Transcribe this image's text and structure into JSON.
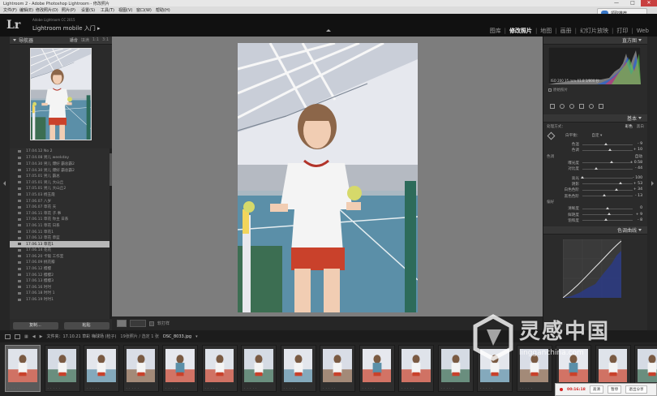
{
  "os": {
    "title": "Lightroom 2 - Adobe Photoshop Lightroom - 修改照片",
    "menu": [
      "文件(F)",
      "编辑(E)",
      "修改照片(D)",
      "照片(P)",
      "设置(S)",
      "工具(T)",
      "视图(V)",
      "窗口(W)",
      "帮助(H)"
    ],
    "share_label": "领取推荐",
    "window_controls": [
      "—",
      "□",
      "✕"
    ]
  },
  "identity": {
    "logo": "Lr",
    "version_line": "Adobe Lightroom CC 2015",
    "mobile_label": "Lightroom mobile 入门",
    "mobile_caret": "▸"
  },
  "modules": [
    "图库",
    "修改照片",
    "地图",
    "画册",
    "幻灯片放映",
    "打印",
    "Web"
  ],
  "module_active": "修改照片",
  "left_panel": {
    "navigator": {
      "title": "导航器",
      "zoom_options": [
        "适合",
        "填满",
        "1:1",
        "3:1"
      ],
      "zoom_active": "适合"
    },
    "history": [
      "17.04.12 No 2",
      "17.04.08 男儿 weekday",
      "17.04.30 男儿 爆好 霸总霸2",
      "17.04.30 男儿 爆好 霸总霸2",
      "17.05.01 男儿 霸总",
      "17.05.01 男儿 大山丘",
      "17.05.01 男儿 大山丘2",
      "17.05.03 杨玉霞",
      "17.06.07 八岁",
      "17.06.07 草花 天",
      "17.06.11 草花 子.事",
      "17.06.11 草花 你主 日系",
      "17.06.11 草花 日系",
      "17.06.11 草花1",
      "17.06.12 草花 草蓝",
      "17.06.13 草花1",
      "17.06.14 花花",
      "17.06.20 卡锻 工作室",
      "17.06.09 桃花瓣",
      "17.06.12 樱樱",
      "17.06.12 樱樱2",
      "17.06.13 樱樱3",
      "17.06.16 时时",
      "17.06.18 时时 1",
      "17.06.19 时时1"
    ],
    "history_selected_index": 15,
    "buttons": [
      "复制...",
      "粘贴"
    ]
  },
  "center_toolbar": {
    "softproof_label": "软打样"
  },
  "right_panel": {
    "histogram_title": "直方图",
    "histogram_info": "ISO 200   35 mm   f/1.8   1/800 秒",
    "original_photo_label": "原始照片",
    "basic_title": "基本",
    "treatment_label": "处理方式：",
    "treatment_options": [
      "彩色",
      "黑白"
    ],
    "treatment_active": "彩色",
    "wb_label": "白平衡：",
    "wb_value": "自定 ▾",
    "sliders_wb": [
      {
        "label": "色温",
        "value": "- 9",
        "pos": 0.46
      },
      {
        "label": "色调",
        "value": "+ 10",
        "pos": 0.55
      }
    ],
    "tone_head": "色调",
    "tone_auto": "自动",
    "sliders_tone": [
      {
        "label": "曝光度",
        "value": "+ 0.58",
        "pos": 0.58
      },
      {
        "label": "对比度",
        "value": "- 44",
        "pos": 0.28
      }
    ],
    "sliders_tone2": [
      {
        "label": "高光",
        "value": "- 100",
        "pos": 0.0
      },
      {
        "label": "阴影",
        "value": "+ 53",
        "pos": 0.76
      },
      {
        "label": "白色色阶",
        "value": "+ 34",
        "pos": 0.67
      },
      {
        "label": "黑色色阶",
        "value": "- 13",
        "pos": 0.44
      }
    ],
    "presence_head": "偏好",
    "sliders_presence": [
      {
        "label": "清晰度",
        "value": "0",
        "pos": 0.5
      },
      {
        "label": "鲜艳度",
        "value": "+ 9",
        "pos": 0.54
      },
      {
        "label": "饱和度",
        "value": "- 8",
        "pos": 0.46
      }
    ],
    "curve_title": "色调曲线"
  },
  "filmstrip": {
    "page_labels": [
      "1",
      "2"
    ],
    "source_text": "文件夹：17.10.21 草彩 嗨球场 (检子)",
    "count_text": "19张照片 / 选定 1 张",
    "filename": "DSC_8033.jpg",
    "filename_caret": "▾",
    "thumb_count": 17,
    "selected_thumb": 0
  },
  "watermark": {
    "cn": "灵感中国",
    "url": "lingganchina.com"
  },
  "recorder": {
    "time": "00:16:18",
    "buttons": [
      "高清",
      "暂停",
      "退出分享"
    ]
  },
  "colors": {
    "accent_active": "#f0f0f0",
    "panel_bg": "#2b2b2b",
    "canvas_bg": "#7d7d7d",
    "record_red": "#d62222"
  }
}
